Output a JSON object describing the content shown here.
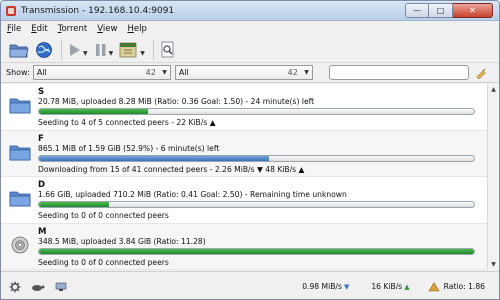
{
  "window": {
    "title": "Transmission - 192.168.10.4:9091",
    "controls": {
      "minimize": "—",
      "maximize": "□",
      "close": "✕"
    }
  },
  "menu": {
    "items": [
      {
        "label": "File",
        "mnemonic": "F",
        "rest": "ile"
      },
      {
        "label": "Edit",
        "mnemonic": "E",
        "rest": "dit"
      },
      {
        "label": "Torrent",
        "mnemonic": "T",
        "rest": "orrent"
      },
      {
        "label": "View",
        "mnemonic": "V",
        "rest": "iew"
      },
      {
        "label": "Help",
        "mnemonic": "H",
        "rest": "elp"
      }
    ]
  },
  "toolbar": {
    "icons": [
      "open-folder-icon",
      "globe-icon",
      "play-icon",
      "pause-icon",
      "queue-icon",
      "properties-icon"
    ]
  },
  "filters": {
    "show_label": "Show:",
    "status_filter": {
      "value": "All",
      "count": "42"
    },
    "tracker_filter": {
      "value": "All",
      "count": "42"
    },
    "search": {
      "value": "",
      "placeholder": ""
    }
  },
  "torrents": [
    {
      "name": "S",
      "progress_text": "20.78 MiB, uploaded 8.28 MiB (Ratio: 0.36 Goal: 1.50) - 24 minute(s) left",
      "status_text": "Seeding to 4 of 5 connected peers - 22 KiB/s ▲",
      "progress": 0.25,
      "bar_color": "#2e9a3a",
      "icon": "folder-icon"
    },
    {
      "name": "F",
      "progress_text": "865.1 MiB of 1.59 GiB (52.9%) - 6 minute(s) left",
      "status_text": "Downloading from 15 of 41 connected peers - 2.26 MiB/s ▼  48 KiB/s ▲",
      "progress": 0.529,
      "bar_color": "#3b72b6",
      "icon": "folder-icon"
    },
    {
      "name": "D",
      "progress_text": "1.66 GiB, uploaded 710.2 MiB (Ratio: 0.41 Goal: 2.50) - Remaining time unknown",
      "status_text": "Seeding to 0 of 0 connected peers",
      "progress": 0.16,
      "bar_color": "#2e9a3a",
      "icon": "folder-icon"
    },
    {
      "name": "M",
      "progress_text": "348.5 MiB, uploaded 3.84 GiB (Ratio: 11.28)",
      "status_text": "Seeding to 0 of 0 connected peers",
      "progress": 1.0,
      "bar_color": "#2e9a3a",
      "icon": "disc-icon"
    }
  ],
  "statusbar": {
    "download_speed": "0.98 MiB/s",
    "upload_speed": "16 KiB/s",
    "ratio": "Ratio: 1.86"
  }
}
